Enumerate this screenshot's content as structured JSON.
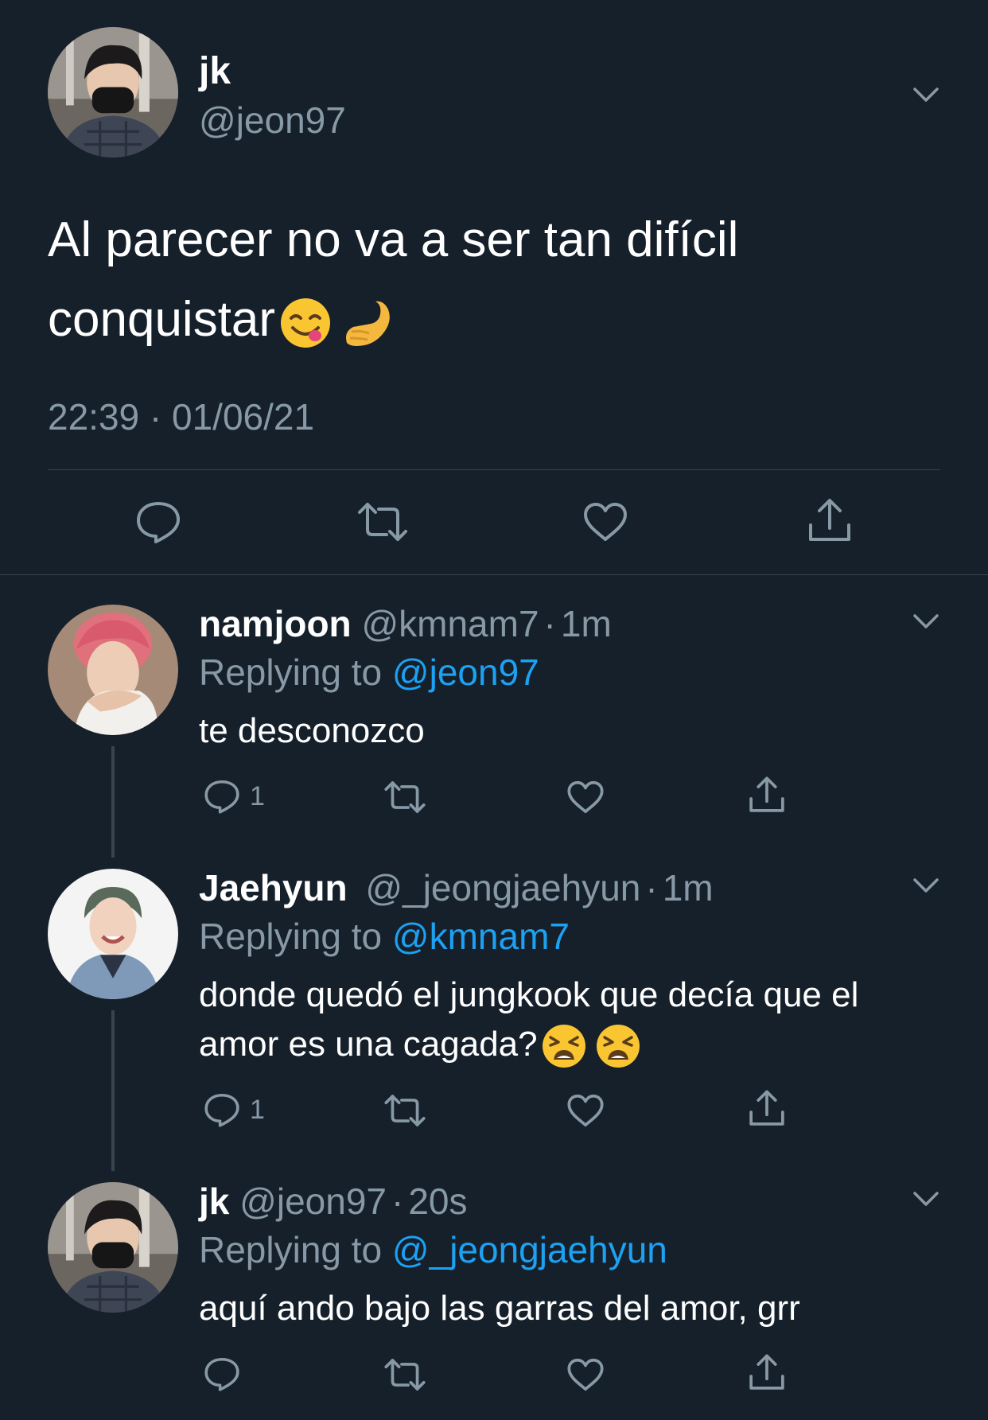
{
  "main_tweet": {
    "display_name": "jk",
    "handle": "@jeon97",
    "text": "Al parecer no va a ser tan difícil conquistar",
    "emojis": [
      "face-savoring-food",
      "pinching-hand"
    ],
    "timestamp": "22:39 · 01/06/21"
  },
  "replies": [
    {
      "display_name": "namjoon",
      "handle": "@kmnam7",
      "dot": "·",
      "age": "1m",
      "replying_to_label": "Replying to",
      "replying_to": "@jeon97",
      "text": "te desconozco",
      "reply_count": "1"
    },
    {
      "display_name": "Jaehyun",
      "handle": "@_jeongjaehyun",
      "dot": "·",
      "age": "1m",
      "replying_to_label": "Replying to",
      "replying_to": "@kmnam7",
      "text_line1": "donde quedó el jungkook que decía que el",
      "text_line2": "amor es una cagada?",
      "emojis": [
        "tired-face",
        "tired-face"
      ],
      "reply_count": "1"
    },
    {
      "display_name": "jk",
      "handle": "@jeon97",
      "dot": "·",
      "age": "20s",
      "replying_to_label": "Replying to",
      "replying_to": "@_jeongjaehyun",
      "text": "aquí ando bajo las garras del amor, grr",
      "reply_count": ""
    }
  ],
  "icons": [
    "reply-icon",
    "retweet-icon",
    "like-icon",
    "share-icon",
    "chevron-down-icon"
  ],
  "colors": {
    "background": "#15202b",
    "divider": "#38444d",
    "muted": "#8899a6",
    "link": "#1da1f2",
    "text": "#ffffff"
  }
}
